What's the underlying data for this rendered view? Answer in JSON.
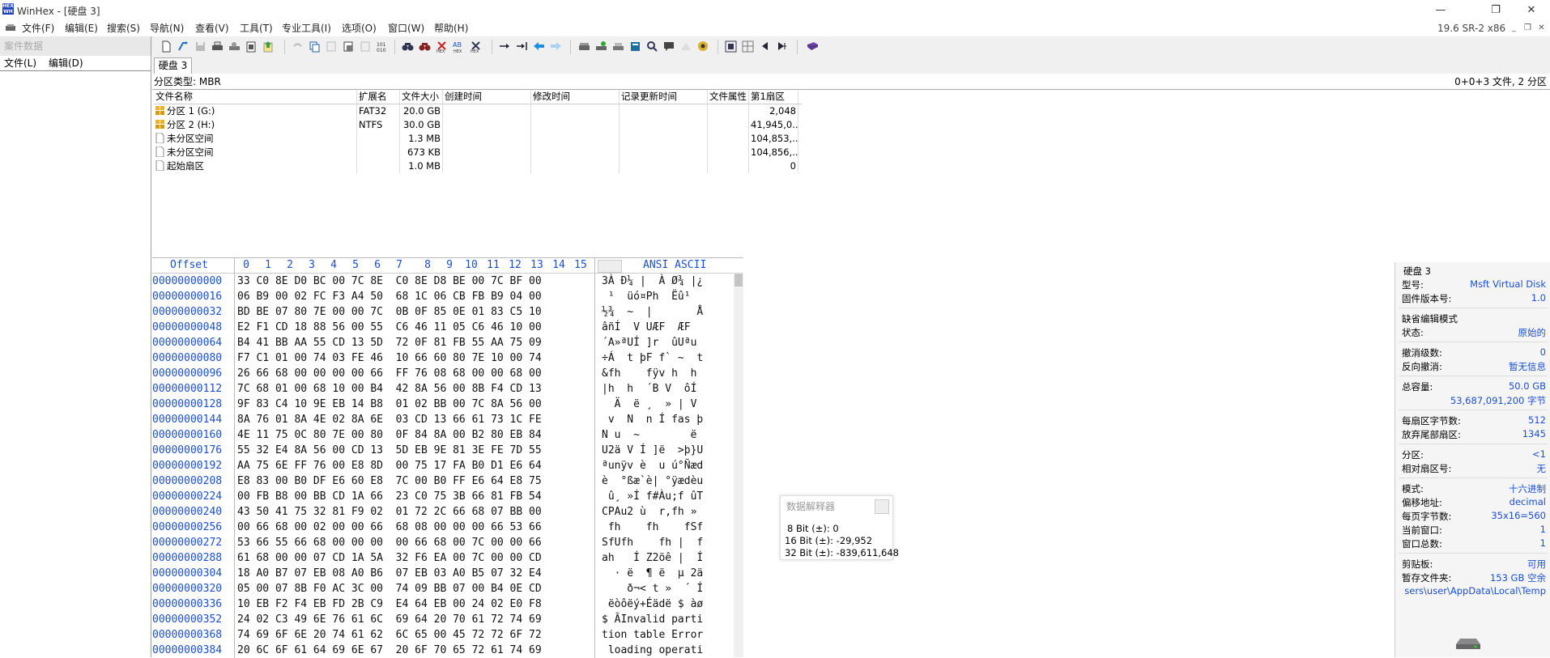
{
  "window": {
    "title": "WinHex - [硬盘 3]",
    "logo_top": "HEX",
    "logo_bottom": "WH",
    "minimize": "—",
    "restore": "❐",
    "close": "✕"
  },
  "menu": {
    "items": [
      "文件(F)",
      "编辑(E)",
      "搜索(S)",
      "导航(N)",
      "查看(V)",
      "工具(T)",
      "专业工具(I)",
      "选项(O)",
      "窗口(W)",
      "帮助(H)"
    ],
    "version": "19.6 SR-2 x86"
  },
  "left_pane": {
    "title": "案件数据",
    "menu": [
      "文件(L)",
      "编辑(D)"
    ]
  },
  "tab": {
    "label": "硬盘 3"
  },
  "partition_info": {
    "left": "分区类型: MBR",
    "right": "0+0+3 文件, 2 分区"
  },
  "file_table": {
    "headers": [
      "文件名称",
      "扩展名",
      "文件大小",
      "创建时间",
      "修改时间",
      "记录更新时间",
      "文件属性",
      "第1扇区"
    ],
    "rows": [
      {
        "name": "分区 1 (G:)",
        "ext": "FAT32",
        "size": "20.0 GB",
        "created": "",
        "modified": "",
        "record": "",
        "attr": "",
        "first": "2,048",
        "icon": "partition-icon"
      },
      {
        "name": "分区 2 (H:)",
        "ext": "NTFS",
        "size": "30.0 GB",
        "created": "",
        "modified": "",
        "record": "",
        "attr": "",
        "first": "41,945,0...",
        "icon": "partition-icon"
      },
      {
        "name": "未分区空间",
        "ext": "",
        "size": "1.3 MB",
        "created": "",
        "modified": "",
        "record": "",
        "attr": "",
        "first": "104,853,...",
        "icon": "file-icon"
      },
      {
        "name": "未分区空间",
        "ext": "",
        "size": "673 KB",
        "created": "",
        "modified": "",
        "record": "",
        "attr": "",
        "first": "104,856,...",
        "icon": "file-icon"
      },
      {
        "name": "起始扇区",
        "ext": "",
        "size": "1.0 MB",
        "created": "",
        "modified": "",
        "record": "",
        "attr": "",
        "first": "0",
        "icon": "file-icon"
      }
    ]
  },
  "hex": {
    "offset_label": "Offset",
    "columns": [
      "0",
      "1",
      "2",
      "3",
      "4",
      "5",
      "6",
      "7",
      "8",
      "9",
      "10",
      "11",
      "12",
      "13",
      "14",
      "15"
    ],
    "ascii_label": "ANSI ASCII",
    "rows": [
      {
        "offset": "00000000000",
        "bytes": "33 C0 8E D0 BC 00 7C 8E  C0 8E D8 BE 00 7C BF 00",
        "ascii": "3À Ð¼ |  À Ø¾ |¿ "
      },
      {
        "offset": "00000000016",
        "bytes": "06 B9 00 02 FC F3 A4 50  68 1C 06 CB FB B9 04 00",
        "ascii": " ¹  üó¤Ph  Ëû¹  "
      },
      {
        "offset": "00000000032",
        "bytes": "BD BE 07 80 7E 00 00 7C  0B 0F 85 0E 01 83 C5 10",
        "ascii": "½¾  ~  |       Å "
      },
      {
        "offset": "00000000048",
        "bytes": "E2 F1 CD 18 88 56 00 55  C6 46 11 05 C6 46 10 00",
        "ascii": "âñÍ  V UÆF  ÆF  "
      },
      {
        "offset": "00000000064",
        "bytes": "B4 41 BB AA 55 CD 13 5D  72 0F 81 FB 55 AA 75 09",
        "ascii": "´A»ªUÍ ]r  ûUªu "
      },
      {
        "offset": "00000000080",
        "bytes": "F7 C1 01 00 74 03 FE 46  10 66 60 80 7E 10 00 74",
        "ascii": "÷Á  t þF f` ~  t"
      },
      {
        "offset": "00000000096",
        "bytes": "26 66 68 00 00 00 00 66  FF 76 08 68 00 00 68 00",
        "ascii": "&fh    fÿv h  h "
      },
      {
        "offset": "00000000112",
        "bytes": "7C 68 01 00 68 10 00 B4  42 8A 56 00 8B F4 CD 13",
        "ascii": "|h  h  ´B V  ôÍ "
      },
      {
        "offset": "00000000128",
        "bytes": "9F 83 C4 10 9E EB 14 B8  01 02 BB 00 7C 8A 56 00",
        "ascii": "  Ä  ë ¸  » | V "
      },
      {
        "offset": "00000000144",
        "bytes": "8A 76 01 8A 4E 02 8A 6E  03 CD 13 66 61 73 1C FE",
        "ascii": " v  N  n Í fas þ"
      },
      {
        "offset": "00000000160",
        "bytes": "4E 11 75 0C 80 7E 00 80  0F 84 8A 00 B2 80 EB 84",
        "ascii": "N u  ~        ë "
      },
      {
        "offset": "00000000176",
        "bytes": "55 32 E4 8A 56 00 CD 13  5D EB 9E 81 3E FE 7D 55",
        "ascii": "U2ä V Í ]ë  >þ}U"
      },
      {
        "offset": "00000000192",
        "bytes": "AA 75 6E FF 76 00 E8 8D  00 75 17 FA B0 D1 E6 64",
        "ascii": "ªunÿv è  u ú°Ñæd"
      },
      {
        "offset": "00000000208",
        "bytes": "E8 83 00 B0 DF E6 60 E8  7C 00 B0 FF E6 64 E8 75",
        "ascii": "è  °ßæ`è| °ÿædèu"
      },
      {
        "offset": "00000000224",
        "bytes": "00 FB B8 00 BB CD 1A 66  23 C0 75 3B 66 81 FB 54",
        "ascii": " û¸ »Í f#Àu;f ûT"
      },
      {
        "offset": "00000000240",
        "bytes": "43 50 41 75 32 81 F9 02  01 72 2C 66 68 07 BB 00",
        "ascii": "CPAu2 ù  r,fh » "
      },
      {
        "offset": "00000000256",
        "bytes": "00 66 68 00 02 00 00 66  68 08 00 00 00 66 53 66",
        "ascii": " fh    fh    fSf"
      },
      {
        "offset": "00000000272",
        "bytes": "53 66 55 66 68 00 00 00  00 66 68 00 7C 00 00 66",
        "ascii": "SfUfh    fh |  f"
      },
      {
        "offset": "00000000288",
        "bytes": "61 68 00 00 07 CD 1A 5A  32 F6 EA 00 7C 00 00 CD",
        "ascii": "ah   Í Z2öê |  Í"
      },
      {
        "offset": "00000000304",
        "bytes": "18 A0 B7 07 EB 08 A0 B6  07 EB 03 A0 B5 07 32 E4",
        "ascii": "  · ë  ¶ ë  µ 2ä"
      },
      {
        "offset": "00000000320",
        "bytes": "05 00 07 8B F0 AC 3C 00  74 09 BB 07 00 B4 0E CD",
        "ascii": "    ð¬< t »  ´ Í"
      },
      {
        "offset": "00000000336",
        "bytes": "10 EB F2 F4 EB FD 2B C9  E4 64 EB 00 24 02 E0 F8",
        "ascii": " ëòôëý+Éädë $ àø"
      },
      {
        "offset": "00000000352",
        "bytes": "24 02 C3 49 6E 76 61 6C  69 64 20 70 61 72 74 69",
        "ascii": "$ ÃInvalid parti"
      },
      {
        "offset": "00000000368",
        "bytes": "74 69 6F 6E 20 74 61 62  6C 65 00 45 72 72 6F 72",
        "ascii": "tion table Error"
      },
      {
        "offset": "00000000384",
        "bytes": "20 6C 6F 61 64 69 6E 67  20 6F 70 65 72 61 74 69",
        "ascii": " loading operati"
      }
    ]
  },
  "data_interpreter": {
    "title": "数据解释器",
    "lines": [
      "8 Bit (±): 0",
      "16 Bit (±): -29,952",
      "32 Bit (±): -839,611,648"
    ]
  },
  "info_pane": {
    "heading": "硬盘 3",
    "groups": [
      [
        {
          "k": "型号:",
          "v": "Msft Virtual Disk"
        },
        {
          "k": "固件版本号:",
          "v": "1.0"
        }
      ],
      [
        {
          "k": "缺省编辑模式",
          "v": ""
        },
        {
          "k": "状态:",
          "v": "原始的"
        }
      ],
      [
        {
          "k": "撤消级数:",
          "v": "0"
        },
        {
          "k": "反向撤消:",
          "v": "暂无信息"
        }
      ],
      [
        {
          "k": "总容量:",
          "v": "50.0 GB"
        },
        {
          "k": "",
          "v": "53,687,091,200 字节"
        }
      ],
      [
        {
          "k": "每扇区字节数:",
          "v": "512"
        },
        {
          "k": "放弃尾部扇区:",
          "v": "1345"
        }
      ],
      [
        {
          "k": "分区:",
          "v": "<1"
        },
        {
          "k": "相对扇区号:",
          "v": "无"
        }
      ],
      [
        {
          "k": "模式:",
          "v": "十六进制"
        },
        {
          "k": "偏移地址:",
          "v": "decimal"
        },
        {
          "k": "每页字节数:",
          "v": "35x16=560"
        },
        {
          "k": "当前窗口:",
          "v": "1"
        },
        {
          "k": "窗口总数:",
          "v": "1"
        }
      ],
      [
        {
          "k": "剪贴板:",
          "v": "可用"
        },
        {
          "k": "暂存文件夹:",
          "v": "153 GB 空余"
        },
        {
          "k": "",
          "v": "sers\\user\\AppData\\Local\\Temp"
        }
      ]
    ]
  },
  "colors": {
    "accent": "#1a4fcf",
    "toolbar": "#f0f0f0"
  }
}
